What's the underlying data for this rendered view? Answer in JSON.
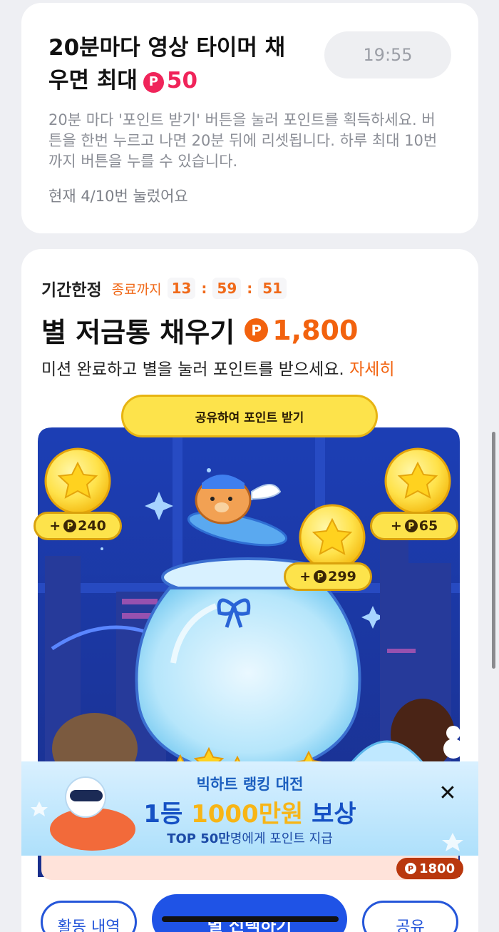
{
  "timer_card": {
    "title_line1": "20분마다 영상 타이머 채",
    "title_line2": "우면 최대",
    "points_icon": "P",
    "max_points": "50",
    "timer": "19:55",
    "description": "20분 마다 '포인트 받기' 버튼을 눌러 포인트를 획득하세요. 버튼을 한번 누르고 나면 20분 뒤에 리셋됩니다. 하루 최대 10번까지 버튼을 누를 수 있습니다.",
    "press_count": "현재 4/10번 눌렀어요"
  },
  "piggy_card": {
    "limited_label": "기간한정",
    "ends_label": "종료까지",
    "countdown": {
      "hours": "13",
      "minutes": "59",
      "seconds": "51"
    },
    "title": "별 저금통 채우기",
    "points_icon": "P",
    "total_points": "1,800",
    "mission_text": "미션 완료하고 별을 눌러 포인트를 받으세요.",
    "detail_link": "자세히",
    "share_bubble": "공유하여 포인트 받기",
    "rewards": [
      {
        "prefix": "+",
        "icon": "P",
        "value": "240"
      },
      {
        "prefix": "+",
        "icon": "P",
        "value": "65"
      },
      {
        "prefix": "+",
        "icon": "P",
        "value": "299"
      }
    ],
    "stacked_total_icon": "P",
    "stacked_total": "1800"
  },
  "banner": {
    "subtitle": "빅하트 랭킹 대전",
    "main_prefix": "1등",
    "main_highlight": "1000만원",
    "main_suffix": "보상",
    "foot_bold": "TOP 50만",
    "foot_rest": "명에게 포인트 지급",
    "close_icon": "✕"
  },
  "bottom_bar": {
    "history_label": "활동 내역",
    "main_label": "별 선택하기",
    "share_label": "공유"
  },
  "colors": {
    "pink": "#f0245a",
    "orange": "#f2620e",
    "blue": "#1f53e6",
    "gold": "#fde34b"
  }
}
